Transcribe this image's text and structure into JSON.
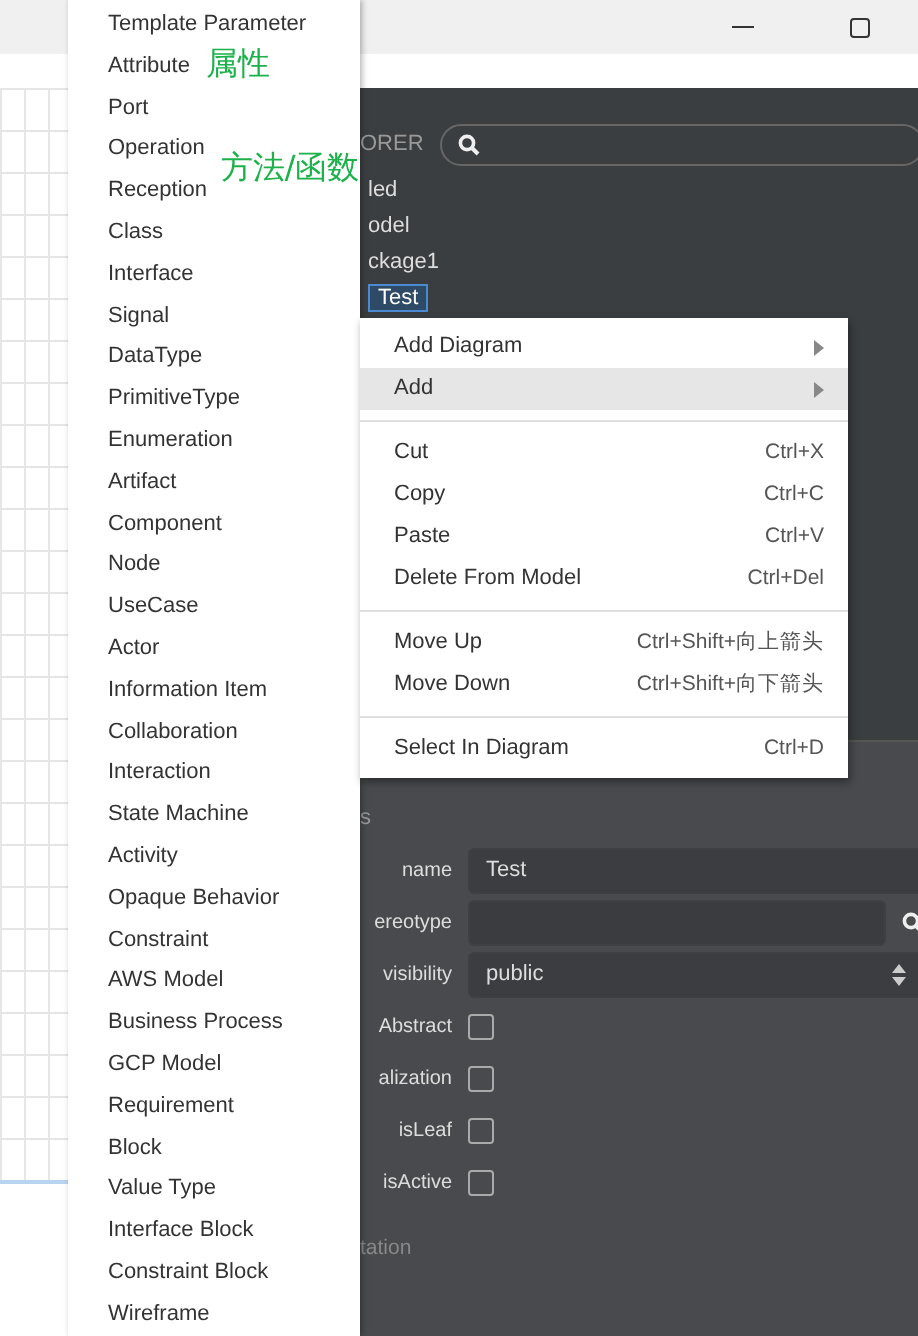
{
  "explorer": {
    "title": "ORER",
    "items": [
      {
        "label": "led",
        "selected": false
      },
      {
        "label": "odel",
        "selected": false
      },
      {
        "label": "ckage1",
        "selected": false
      },
      {
        "label": "Test",
        "selected": true
      }
    ]
  },
  "properties": {
    "section": "s",
    "rows": [
      {
        "kind": "text",
        "label": "name",
        "value": "Test"
      },
      {
        "kind": "search",
        "label": "ereotype"
      },
      {
        "kind": "select",
        "label": "visibility",
        "value": "public"
      },
      {
        "kind": "checkbox",
        "label": "Abstract",
        "checked": false
      },
      {
        "kind": "checkbox",
        "label": "alization",
        "checked": false
      },
      {
        "kind": "checkbox",
        "label": "isLeaf",
        "checked": false
      },
      {
        "kind": "checkbox",
        "label": "isActive",
        "checked": false
      }
    ],
    "footer": "tation"
  },
  "context_menu": {
    "groups": [
      [
        {
          "label": "Add Diagram",
          "kind": "submenu",
          "selected": false
        },
        {
          "label": "Add",
          "kind": "submenu",
          "selected": true
        }
      ],
      [
        {
          "label": "Cut",
          "kind": "command",
          "shortcut": "Ctrl+X",
          "selected": false
        },
        {
          "label": "Copy",
          "kind": "command",
          "shortcut": "Ctrl+C",
          "selected": false
        },
        {
          "label": "Paste",
          "kind": "command",
          "shortcut": "Ctrl+V",
          "selected": false
        },
        {
          "label": "Delete From Model",
          "kind": "command",
          "shortcut": "Ctrl+Del",
          "selected": false
        }
      ],
      [
        {
          "label": "Move Up",
          "kind": "command",
          "shortcut": "Ctrl+Shift+向上箭头",
          "selected": false
        },
        {
          "label": "Move Down",
          "kind": "command",
          "shortcut": "Ctrl+Shift+向下箭头",
          "selected": false
        }
      ],
      [
        {
          "label": "Select In Diagram",
          "kind": "command",
          "shortcut": "Ctrl+D",
          "selected": false
        }
      ]
    ]
  },
  "add_submenu": {
    "items": [
      {
        "label": "Template Parameter"
      },
      {
        "label": "Attribute",
        "note": "属性"
      },
      {
        "label": "Port"
      },
      {
        "label": "Operation",
        "note": "方法/函数"
      },
      {
        "label": "Reception"
      },
      {
        "label": "Class"
      },
      {
        "label": "Interface"
      },
      {
        "label": "Signal"
      },
      {
        "label": "DataType"
      },
      {
        "label": "PrimitiveType"
      },
      {
        "label": "Enumeration"
      },
      {
        "label": "Artifact"
      },
      {
        "label": "Component"
      },
      {
        "label": "Node"
      },
      {
        "label": "UseCase"
      },
      {
        "label": "Actor"
      },
      {
        "label": "Information Item"
      },
      {
        "label": "Collaboration"
      },
      {
        "label": "Interaction"
      },
      {
        "label": "State Machine"
      },
      {
        "label": "Activity"
      },
      {
        "label": "Opaque Behavior"
      },
      {
        "label": "Constraint"
      },
      {
        "label": "AWS Model"
      },
      {
        "label": "Business Process"
      },
      {
        "label": "GCP Model"
      },
      {
        "label": "Requirement"
      },
      {
        "label": "Block"
      },
      {
        "label": "Value Type"
      },
      {
        "label": "Interface Block"
      },
      {
        "label": "Constraint Block"
      },
      {
        "label": "Wireframe"
      }
    ]
  }
}
